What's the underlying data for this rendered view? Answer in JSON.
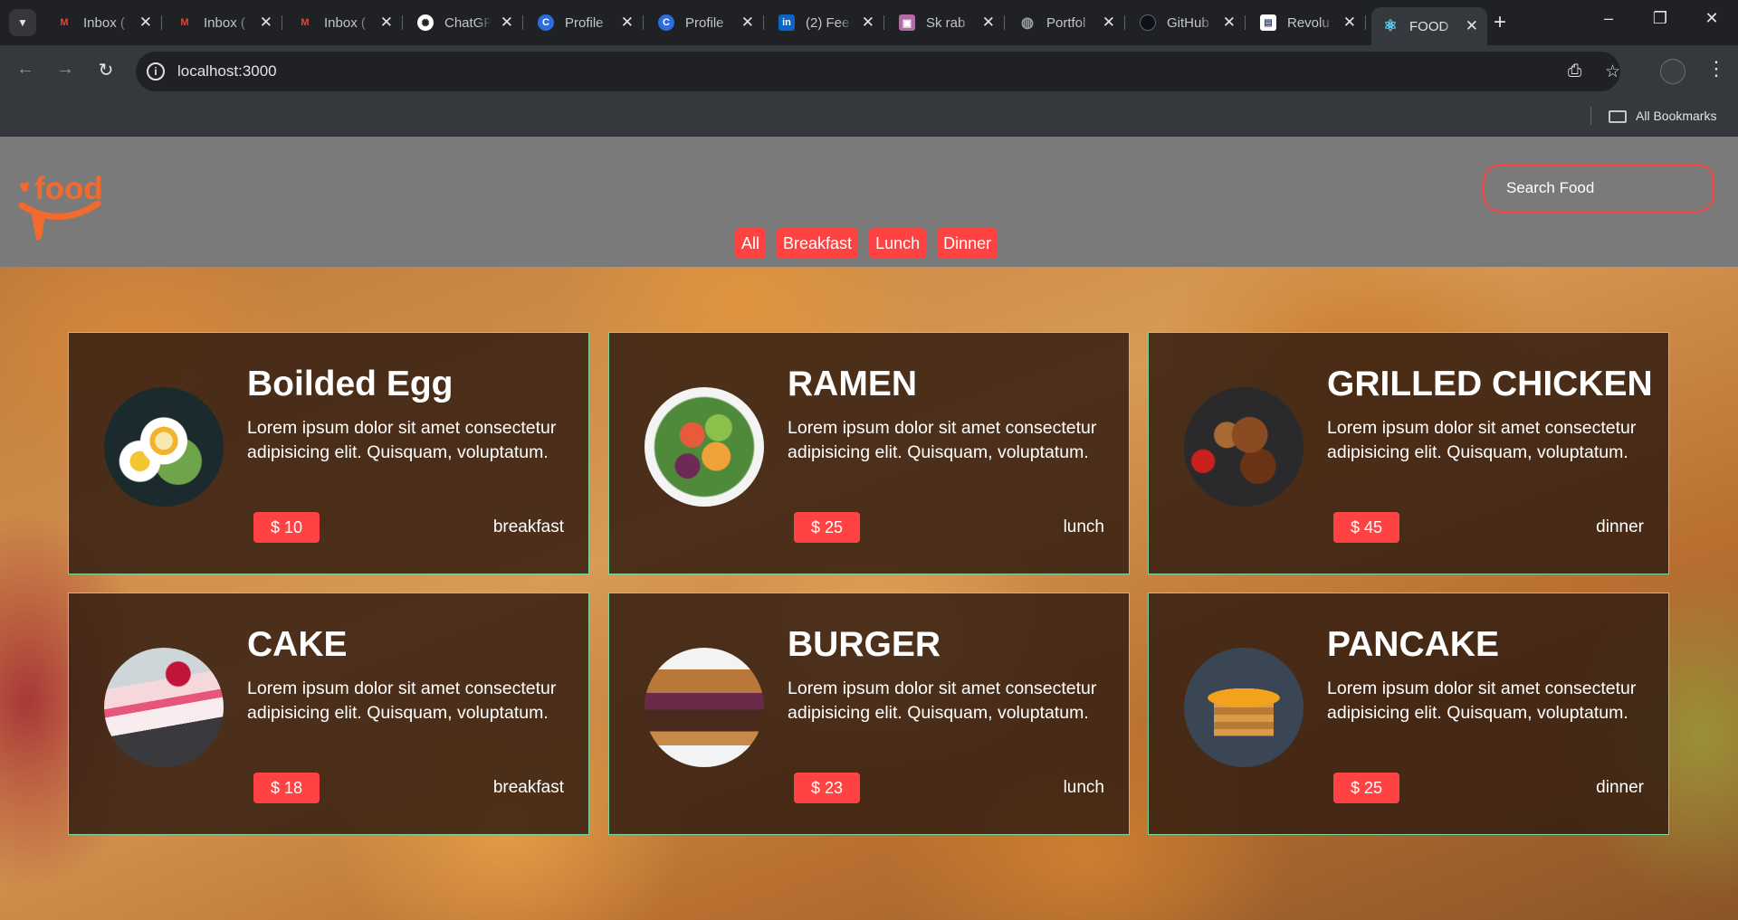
{
  "browser": {
    "tabs": [
      {
        "label": "Inbox (",
        "icon": "gmail-icon",
        "color": "#ea4335",
        "glyph": "M"
      },
      {
        "label": "Inbox (",
        "icon": "gmail-icon",
        "color": "#ea4335",
        "glyph": "M"
      },
      {
        "label": "Inbox (",
        "icon": "gmail-icon",
        "color": "#ea4335",
        "glyph": "M"
      },
      {
        "label": "ChatGPT",
        "icon": "chatgpt-icon",
        "color": "#ffffff",
        "glyph": "✺"
      },
      {
        "label": "Profile",
        "icon": "profile-icon",
        "color": "#2d6cdf",
        "glyph": "C"
      },
      {
        "label": "Profile",
        "icon": "profile-icon",
        "color": "#2d6cdf",
        "glyph": "C"
      },
      {
        "label": "(2) Fee",
        "icon": "linkedin-icon",
        "color": "#0a66c2",
        "glyph": "in"
      },
      {
        "label": "Sk rab",
        "icon": "image-icon",
        "color": "#b56aa8",
        "glyph": "▣"
      },
      {
        "label": "Portfol",
        "icon": "globe-icon",
        "color": "#9aa0a6",
        "glyph": "◍"
      },
      {
        "label": "GitHub",
        "icon": "github-icon",
        "color": "#1f2124",
        "glyph": "●"
      },
      {
        "label": "Revolu",
        "icon": "page-icon",
        "color": "#ffffff",
        "glyph": "▤"
      },
      {
        "label": "FOOD",
        "icon": "react-icon",
        "color": "#61dafb",
        "glyph": "⚛"
      }
    ],
    "tab_search_icon": "chevron-down-icon",
    "new_tab_glyph": "+",
    "url": "localhost:3000",
    "bookmarks_label": "All Bookmarks"
  },
  "app": {
    "logo_text": "food",
    "search_placeholder": "Search Food",
    "accent": "#ff4343",
    "card_border": "#79d79a",
    "filters": [
      "All",
      "Breakfast",
      "Lunch",
      "Dinner"
    ],
    "foods": [
      {
        "name": "Boilded Egg",
        "text": "Lorem ipsum dolor sit amet consectetur adipisicing elit. Quisquam, voluptatum.",
        "price": "$ 10",
        "type": "breakfast",
        "image": "boiled-egg-image"
      },
      {
        "name": "RAMEN",
        "text": "Lorem ipsum dolor sit amet consectetur adipisicing elit. Quisquam, voluptatum.",
        "price": "$ 25",
        "type": "lunch",
        "image": "ramen-image"
      },
      {
        "name": "GRILLED CHICKEN",
        "text": "Lorem ipsum dolor sit amet consectetur adipisicing elit. Quisquam, voluptatum.",
        "price": "$ 45",
        "type": "dinner",
        "image": "grilled-chicken-image"
      },
      {
        "name": "CAKE",
        "text": "Lorem ipsum dolor sit amet consectetur adipisicing elit. Quisquam, voluptatum.",
        "price": "$ 18",
        "type": "breakfast",
        "image": "cake-image"
      },
      {
        "name": "BURGER",
        "text": "Lorem ipsum dolor sit amet consectetur adipisicing elit. Quisquam, voluptatum.",
        "price": "$ 23",
        "type": "lunch",
        "image": "burger-image"
      },
      {
        "name": "PANCAKE",
        "text": "Lorem ipsum dolor sit amet consectetur adipisicing elit. Quisquam, voluptatum.",
        "price": "$ 25",
        "type": "dinner",
        "image": "pancake-image"
      }
    ]
  }
}
